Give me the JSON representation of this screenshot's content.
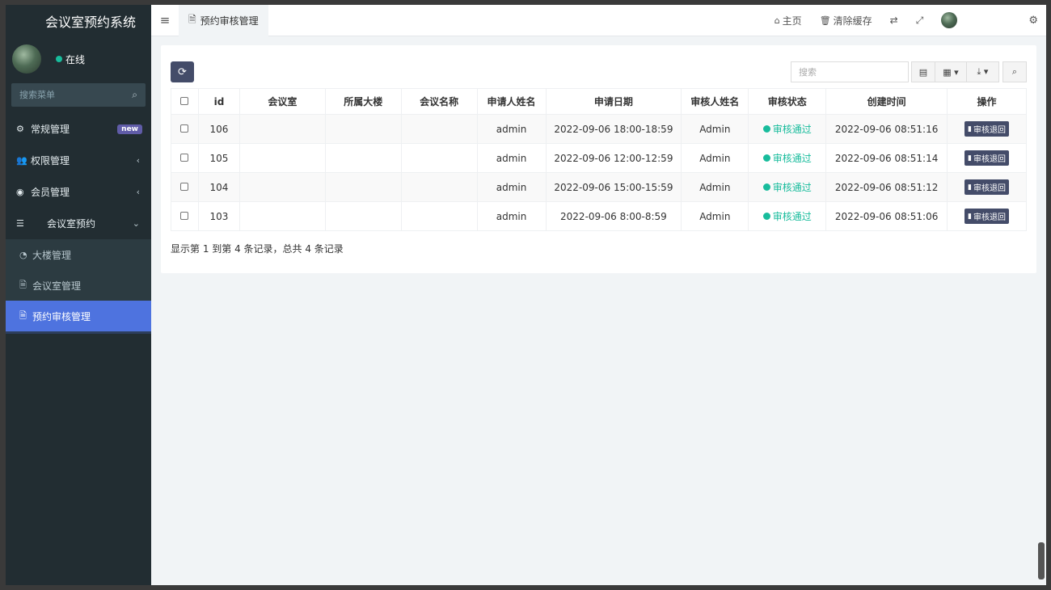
{
  "app": {
    "title": "会议室预约系统",
    "user_status": "在线"
  },
  "sidebar": {
    "search_placeholder": "搜索菜单",
    "items": [
      {
        "label": "常规管理",
        "icon": "gears-icon",
        "badge": "new"
      },
      {
        "label": "权限管理",
        "icon": "users-icon",
        "chevron": "‹"
      },
      {
        "label": "会员管理",
        "icon": "user-circle-icon",
        "chevron": "‹"
      },
      {
        "label": "会议室预约",
        "icon": "list-icon",
        "chevron": "⌄"
      }
    ],
    "subitems": [
      {
        "label": "大楼管理",
        "icon": "dashboard-icon"
      },
      {
        "label": "会议室管理",
        "icon": "file-icon"
      },
      {
        "label": "预约审核管理",
        "icon": "file-icon",
        "active": true
      }
    ]
  },
  "header": {
    "tab_label": "预约审核管理",
    "home_label": "主页",
    "clear_cache_label": "清除缓存"
  },
  "toolbar": {
    "search_placeholder": "搜索"
  },
  "table": {
    "columns": [
      "id",
      "会议室",
      "所属大楼",
      "会议名称",
      "申请人姓名",
      "申请日期",
      "审核人姓名",
      "审核状态",
      "创建时间",
      "操作"
    ],
    "rows": [
      {
        "id": "106",
        "room": "",
        "building": "",
        "meeting": "",
        "applicant": "admin",
        "date": "2022-09-06 18:00-18:59",
        "reviewer": "Admin",
        "status": "审核通过",
        "created": "2022-09-06 08:51:16",
        "action": "审核退回"
      },
      {
        "id": "105",
        "room": "",
        "building": "",
        "meeting": "",
        "applicant": "admin",
        "date": "2022-09-06 12:00-12:59",
        "reviewer": "Admin",
        "status": "审核通过",
        "created": "2022-09-06 08:51:14",
        "action": "审核退回"
      },
      {
        "id": "104",
        "room": "",
        "building": "",
        "meeting": "",
        "applicant": "admin",
        "date": "2022-09-06 15:00-15:59",
        "reviewer": "Admin",
        "status": "审核通过",
        "created": "2022-09-06 08:51:12",
        "action": "审核退回"
      },
      {
        "id": "103",
        "room": "",
        "building": "",
        "meeting": "",
        "applicant": "admin",
        "date": "2022-09-06 8:00-8:59",
        "reviewer": "Admin",
        "status": "审核通过",
        "created": "2022-09-06 08:51:06",
        "action": "审核退回"
      }
    ],
    "footer": "显示第 1 到第 4 条记录，总共 4 条记录"
  },
  "colors": {
    "sidebar_bg": "#222d32",
    "active": "#4e73df",
    "success": "#18bc9c",
    "button_dark": "#444c69"
  }
}
